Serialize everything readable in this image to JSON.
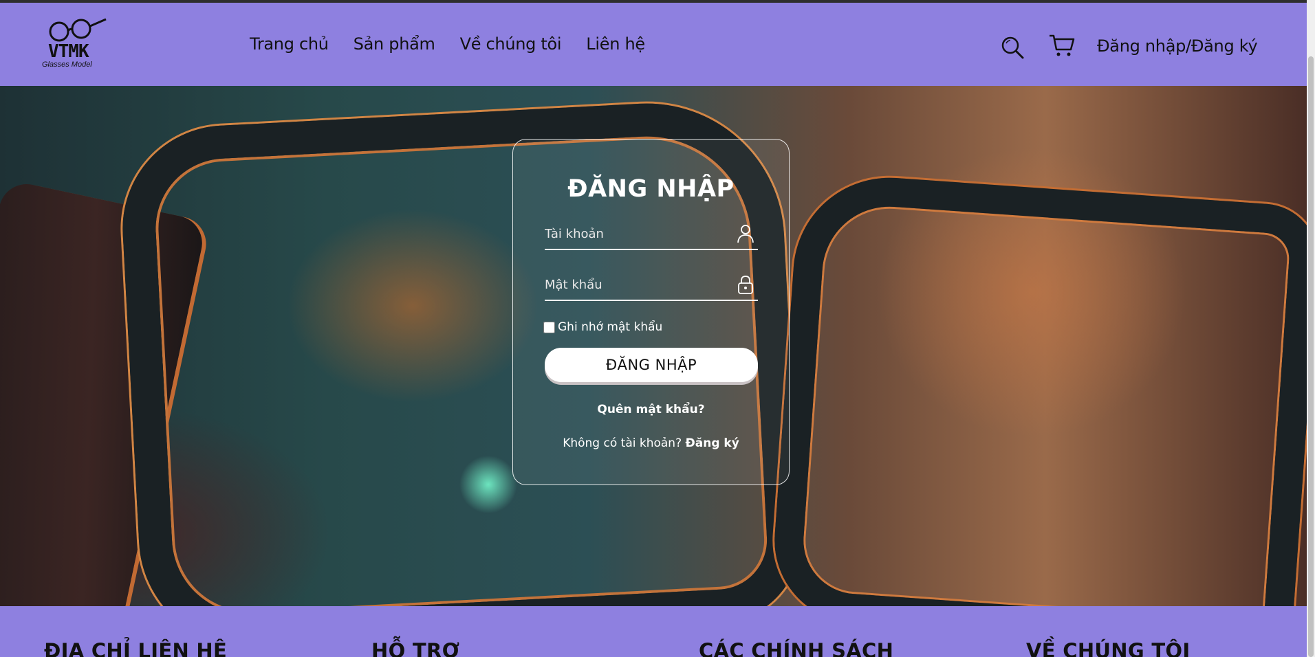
{
  "brand": {
    "name": "VTMK",
    "tagline": "Glasses Model"
  },
  "nav": {
    "items": [
      {
        "label": "Trang chủ"
      },
      {
        "label": "Sản phẩm"
      },
      {
        "label": "Về chúng tôi"
      },
      {
        "label": "Liên hệ"
      }
    ],
    "auth_label": "Đăng nhập/Đăng ký",
    "icons": [
      "search-icon",
      "cart-icon"
    ]
  },
  "login": {
    "title": "ĐĂNG NHẬP",
    "username_placeholder": "Tài khoản",
    "password_placeholder": "Mật khẩu",
    "remember_label": "Ghi nhớ mật khẩu",
    "submit_label": "ĐĂNG NHẬP",
    "forgot_label": "Quên mật khẩu?",
    "no_account_text": "Không có tài khoản?",
    "signup_label": "Đăng ký"
  },
  "footer": {
    "columns": [
      {
        "title": "ĐỊA CHỈ LIÊN HỆ"
      },
      {
        "title": "HỖ TRỢ"
      },
      {
        "title": "CÁC CHÍNH SÁCH"
      },
      {
        "title": "VỀ CHÚNG TÔI"
      }
    ]
  },
  "colors": {
    "header_bg": "#8e80e0",
    "text_dark": "#111111",
    "card_border": "#ffffff"
  }
}
